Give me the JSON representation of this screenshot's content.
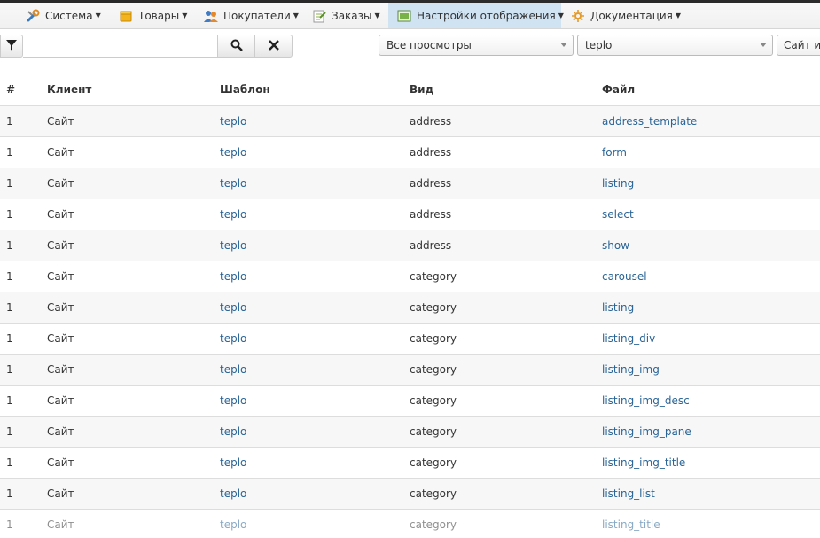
{
  "menu": [
    {
      "label": "Система",
      "icon": "tools-icon"
    },
    {
      "label": "Товары",
      "icon": "box-icon"
    },
    {
      "label": "Покупатели",
      "icon": "users-icon"
    },
    {
      "label": "Заказы",
      "icon": "orders-icon"
    },
    {
      "label": "Настройки отображения",
      "icon": "display-settings-icon",
      "active": true
    },
    {
      "label": "Документация",
      "icon": "docs-icon"
    }
  ],
  "toolbar": {
    "search_value": "",
    "search_placeholder": "",
    "views_select": "Все просмотры",
    "template_select": "teplo",
    "client_select": "Сайт и"
  },
  "table": {
    "headers": {
      "num": "#",
      "client": "Клиент",
      "template": "Шаблон",
      "view": "Вид",
      "file": "Файл"
    },
    "rows": [
      {
        "num": "1",
        "client": "Сайт",
        "template": "teplo",
        "view": "address",
        "file": "address_template"
      },
      {
        "num": "1",
        "client": "Сайт",
        "template": "teplo",
        "view": "address",
        "file": "form"
      },
      {
        "num": "1",
        "client": "Сайт",
        "template": "teplo",
        "view": "address",
        "file": "listing"
      },
      {
        "num": "1",
        "client": "Сайт",
        "template": "teplo",
        "view": "address",
        "file": "select"
      },
      {
        "num": "1",
        "client": "Сайт",
        "template": "teplo",
        "view": "address",
        "file": "show"
      },
      {
        "num": "1",
        "client": "Сайт",
        "template": "teplo",
        "view": "category",
        "file": "carousel"
      },
      {
        "num": "1",
        "client": "Сайт",
        "template": "teplo",
        "view": "category",
        "file": "listing"
      },
      {
        "num": "1",
        "client": "Сайт",
        "template": "teplo",
        "view": "category",
        "file": "listing_div"
      },
      {
        "num": "1",
        "client": "Сайт",
        "template": "teplo",
        "view": "category",
        "file": "listing_img"
      },
      {
        "num": "1",
        "client": "Сайт",
        "template": "teplo",
        "view": "category",
        "file": "listing_img_desc"
      },
      {
        "num": "1",
        "client": "Сайт",
        "template": "teplo",
        "view": "category",
        "file": "listing_img_pane"
      },
      {
        "num": "1",
        "client": "Сайт",
        "template": "teplo",
        "view": "category",
        "file": "listing_img_title"
      },
      {
        "num": "1",
        "client": "Сайт",
        "template": "teplo",
        "view": "category",
        "file": "listing_list"
      },
      {
        "num": "1",
        "client": "Сайт",
        "template": "teplo",
        "view": "category",
        "file": "listing_title"
      }
    ]
  },
  "colors": {
    "link": "#2a6496",
    "active_menu": "#cfe3f3"
  }
}
